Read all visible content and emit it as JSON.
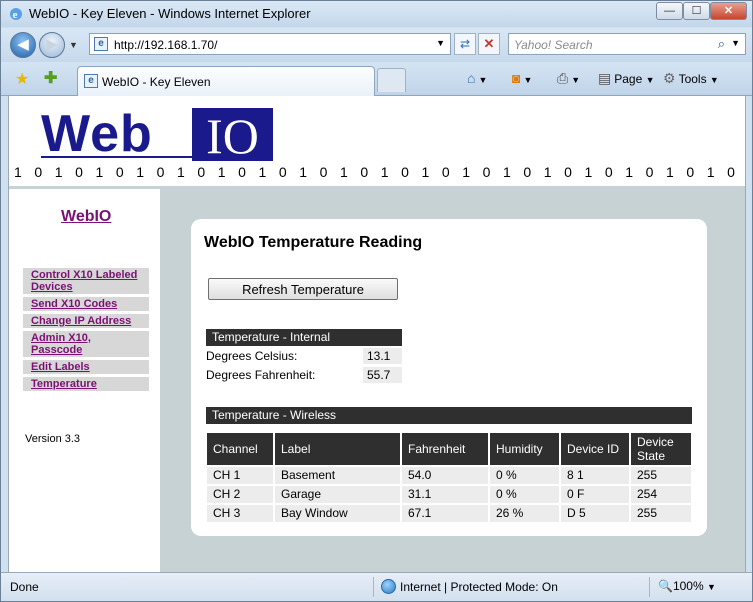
{
  "window": {
    "title": "WebIO - Key Eleven - Windows Internet Explorer",
    "minimize": "—",
    "maximize": "☐",
    "close": "✕"
  },
  "browser": {
    "url": "http://192.168.1.70/",
    "search_placeholder": "Yahoo! Search",
    "tab_title": "WebIO - Key Eleven",
    "page_menu": "Page",
    "tools_menu": "Tools",
    "home_icon": "home-icon",
    "feeds_icon": "feeds-icon",
    "print_icon": "print-icon"
  },
  "header": {
    "logo_web": "Web",
    "logo_io": "IO",
    "binary_strip": "1 0 1 0 1 0 1 0 1 0 1 0 1 0 1 0 1 0 1 0 1 0 1 0 1 0 1 0 1 0 1 0 1 0 1 0 1 0 1 0 1 0"
  },
  "sidebar": {
    "brand": "WebIO",
    "menu": [
      {
        "label": "Control X10 Labeled Devices"
      },
      {
        "label": "Send X10 Codes"
      },
      {
        "label": "Change IP Address"
      },
      {
        "label": "Admin X10, Passcode"
      },
      {
        "label": "Edit Labels"
      },
      {
        "label": "Temperature"
      }
    ],
    "version": "Version 3.3"
  },
  "main": {
    "title": "WebIO Temperature Reading",
    "refresh_button": "Refresh Temperature",
    "internal": {
      "header": "Temperature - Internal",
      "celsius_label": "Degrees Celsius:",
      "celsius_value": "13.1",
      "fahrenheit_label": "Degrees Fahrenheit:",
      "fahrenheit_value": "55.7"
    },
    "wireless": {
      "header": "Temperature - Wireless",
      "columns": [
        "Channel",
        "Label",
        "Fahrenheit",
        "Humidity",
        "Device ID",
        "Device State"
      ],
      "rows": [
        [
          "CH 1",
          "Basement",
          "54.0",
          "0 %",
          "8 1",
          "255"
        ],
        [
          "CH 2",
          "Garage",
          "31.1",
          "0 %",
          "0 F",
          "254"
        ],
        [
          "CH 3",
          "Bay Window",
          "67.1",
          "26 %",
          "D 5",
          "255"
        ]
      ]
    }
  },
  "status": {
    "left": "Done",
    "zone": "Internet | Protected Mode: On",
    "zoom": "100%"
  }
}
